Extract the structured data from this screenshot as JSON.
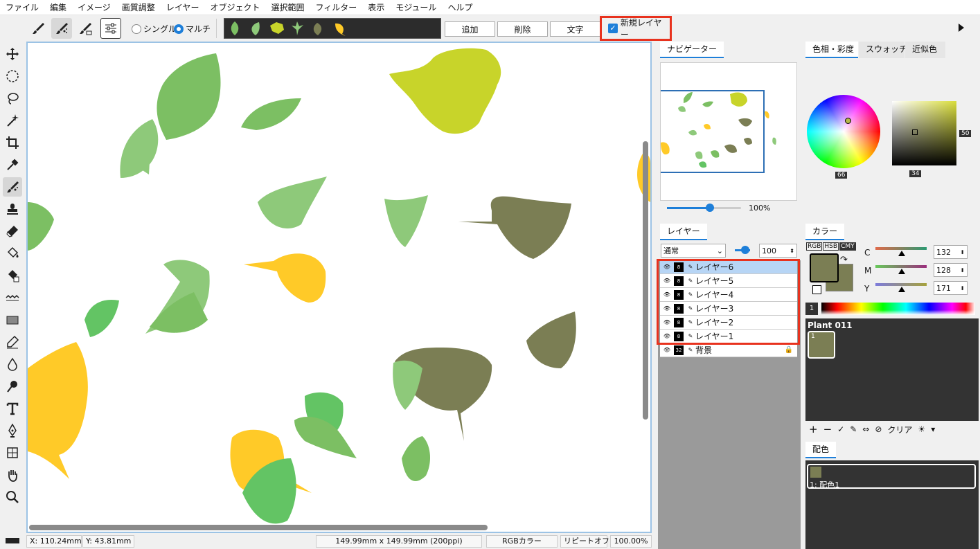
{
  "menu": [
    "ファイル",
    "編集",
    "イメージ",
    "画質調整",
    "レイヤー",
    "オブジェクト",
    "選択範囲",
    "フィルター",
    "表示",
    "モジュール",
    "ヘルプ"
  ],
  "toolbar": {
    "radio_single": "シングル",
    "radio_multi": "マルチ",
    "selected_mode": "マルチ",
    "add_label": "追加",
    "delete_label": "削除",
    "text_label": "文字",
    "new_layer_label": "新規レイヤー",
    "new_layer_checked": true
  },
  "status": {
    "x": "X:  110.24mm",
    "y": "Y:   43.81mm",
    "size": "149.99mm x 149.99mm (200ppi)",
    "mode": "RGBカラー",
    "repeat": "リピートオフ",
    "zoom": "100.00%"
  },
  "navigator": {
    "tab": "ナビゲーター",
    "zoom": "100%",
    "zoom_level": 0.58
  },
  "layers": {
    "tab": "レイヤー",
    "blend_mode": "通常",
    "opacity": "100",
    "items": [
      {
        "name": "レイヤー6",
        "depth": "8",
        "selected": true
      },
      {
        "name": "レイヤー5",
        "depth": "8",
        "selected": false
      },
      {
        "name": "レイヤー4",
        "depth": "8",
        "selected": false
      },
      {
        "name": "レイヤー3",
        "depth": "8",
        "selected": false
      },
      {
        "name": "レイヤー2",
        "depth": "8",
        "selected": false
      },
      {
        "name": "レイヤー1",
        "depth": "8",
        "selected": false
      },
      {
        "name": "背景",
        "depth": "32",
        "selected": false,
        "locked": true
      }
    ]
  },
  "color_panel": {
    "tabs": [
      "色相・彩度",
      "スウォッチ",
      "近似色"
    ],
    "active_tab": "色相・彩度",
    "hue_value": "66",
    "saturation_value": "34",
    "brightness_value": "50"
  },
  "color_values": {
    "tab": "カラー",
    "modes": [
      "RGB",
      "HSB",
      "CMY"
    ],
    "active_mode": "CMY",
    "c": "132",
    "m": "128",
    "y": "171",
    "c_label": "C",
    "m_label": "M",
    "y_label": "Y",
    "foreground": "#7b7e54",
    "background": "#7b7e54",
    "palette_index": "1"
  },
  "swatches": {
    "title": "Plant 011",
    "swatch_index": "1",
    "clear_label": "クリア"
  },
  "scheme": {
    "tab": "配色",
    "item_label": "1: 配色1"
  },
  "leaf_colors": {
    "dark_olive": "#7b7e54",
    "light_green": "#8ec97a",
    "mid_green": "#7cbf63",
    "bright_green": "#63c464",
    "yellow_green": "#c8d42a",
    "yellow": "#ffca28"
  }
}
